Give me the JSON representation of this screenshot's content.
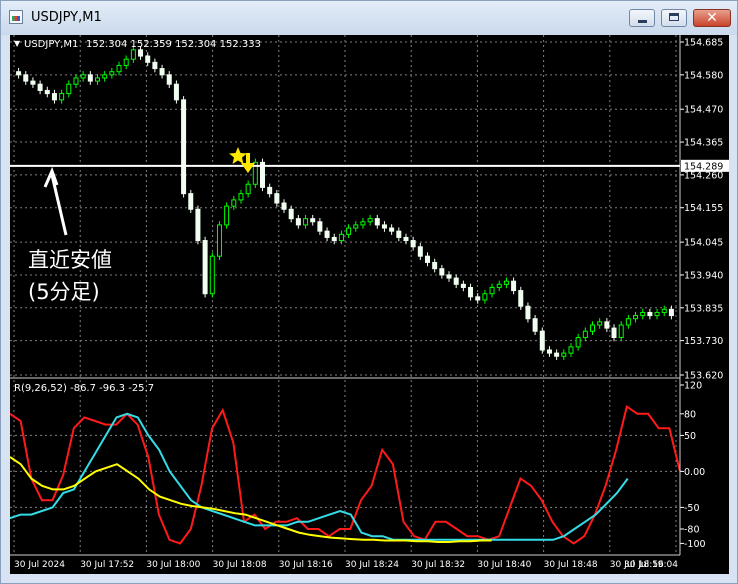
{
  "window": {
    "title": "USDJPY,M1",
    "buttons": {
      "minimize": "minimize-icon",
      "maximize": "maximize-icon",
      "close": "close-icon"
    }
  },
  "chart_data": [
    {
      "type": "candlestick",
      "title": "USDJPY,M1 152.304 152.359 152.304 152.333",
      "symbol": "USDJPY,M1",
      "ohlc_header": "152.304 152.359 152.304 152.333",
      "ylim": [
        153.62,
        154.685
      ],
      "price_ticks": [
        "154.685",
        "154.580",
        "154.470",
        "154.365",
        "154.260",
        "154.155",
        "154.045",
        "153.940",
        "153.835",
        "153.730",
        "153.620"
      ],
      "horizontal_line": {
        "value": 154.289,
        "label": "154.289"
      },
      "annotation": {
        "line1": "直近安値",
        "line2": "(5分足)"
      },
      "close_series": [
        154.58,
        154.56,
        154.55,
        154.53,
        154.52,
        154.5,
        154.52,
        154.55,
        154.57,
        154.58,
        154.56,
        154.57,
        154.58,
        154.59,
        154.61,
        154.63,
        154.66,
        154.64,
        154.62,
        154.6,
        154.58,
        154.55,
        154.5,
        154.2,
        154.15,
        154.05,
        153.88,
        154.0,
        154.1,
        154.16,
        154.18,
        154.2,
        154.23,
        154.3,
        154.22,
        154.2,
        154.17,
        154.15,
        154.12,
        154.1,
        154.12,
        154.11,
        154.08,
        154.06,
        154.05,
        154.07,
        154.09,
        154.1,
        154.11,
        154.12,
        154.1,
        154.09,
        154.08,
        154.06,
        154.05,
        154.03,
        154.0,
        153.98,
        153.96,
        153.94,
        153.93,
        153.91,
        153.9,
        153.87,
        153.86,
        153.88,
        153.9,
        153.91,
        153.92,
        153.89,
        153.84,
        153.8,
        153.76,
        153.7,
        153.69,
        153.68,
        153.69,
        153.71,
        153.74,
        153.76,
        153.78,
        153.79,
        153.77,
        153.74,
        153.78,
        153.8,
        153.81,
        153.82,
        153.81,
        153.82,
        153.83,
        153.81
      ]
    },
    {
      "type": "line",
      "title": "R(9,26,52) -86.7 -96.3 -25.7",
      "ylim": [
        -105,
        120
      ],
      "y_ticks": [
        "120",
        "80",
        "50",
        "0.00",
        "-50",
        "-80",
        "-100"
      ],
      "series": [
        {
          "color": "#ff1a1a",
          "values": [
            80,
            70,
            -10,
            -40,
            -40,
            -5,
            60,
            75,
            70,
            65,
            65,
            80,
            65,
            20,
            -60,
            -95,
            -100,
            -80,
            -20,
            60,
            85,
            40,
            -70,
            -60,
            -80,
            -70,
            -70,
            -65,
            -80,
            -80,
            -90,
            -80,
            -80,
            -40,
            -20,
            30,
            10,
            -70,
            -90,
            -95,
            -70,
            -70,
            -80,
            -90,
            -90,
            -95,
            -90,
            -50,
            -10,
            -20,
            -40,
            -70,
            -90,
            -100,
            -90,
            -60,
            -20,
            30,
            90,
            80,
            80,
            60,
            60,
            0
          ]
        },
        {
          "color": "#33dde8",
          "values": [
            -65,
            -60,
            -60,
            -55,
            -50,
            -30,
            -25,
            0,
            25,
            50,
            75,
            80,
            75,
            50,
            30,
            0,
            -20,
            -40,
            -50,
            -55,
            -60,
            -65,
            -70,
            -75,
            -75,
            -75,
            -75,
            -70,
            -70,
            -65,
            -60,
            -55,
            -60,
            -85,
            -90,
            -90,
            -95,
            -95,
            -95,
            -95,
            -95,
            -95,
            -95,
            -95,
            -95,
            -95,
            -95,
            -95,
            -95,
            -95,
            -95,
            -95,
            -90,
            -80,
            -70,
            -60,
            -45,
            -30,
            -10
          ]
        },
        {
          "color": "#ffff00",
          "values": [
            20,
            10,
            -10,
            -20,
            -25,
            -25,
            -20,
            -10,
            0,
            5,
            10,
            0,
            -10,
            -25,
            -35,
            -40,
            -45,
            -48,
            -50,
            -52,
            -55,
            -58,
            -60,
            -65,
            -70,
            -75,
            -80,
            -85,
            -88,
            -90,
            -92,
            -93,
            -94,
            -95,
            -95,
            -96,
            -96,
            -96,
            -97,
            -97,
            -98,
            -98,
            -97,
            -97,
            -96,
            -96
          ]
        }
      ]
    }
  ],
  "x_tick_labels": [
    "30 Jul 2024",
    "30 Jul 17:52",
    "30 Jul 18:00",
    "30 Jul 18:08",
    "30 Jul 18:16",
    "30 Jul 18:24",
    "30 Jul 18:32",
    "30 Jul 18:40",
    "30 Jul 18:48",
    "30 Jul 18:56",
    "30 Jul 19:04"
  ],
  "colors": {
    "background": "#000000",
    "grid": "#808080",
    "candle_bull": "#00ff00",
    "candle_bear": "#f0fff0",
    "signal": "#ffe800",
    "text": "#ffffff"
  },
  "signal_icons": {
    "star": "star-icon",
    "arrow": "arrow-down-icon"
  }
}
